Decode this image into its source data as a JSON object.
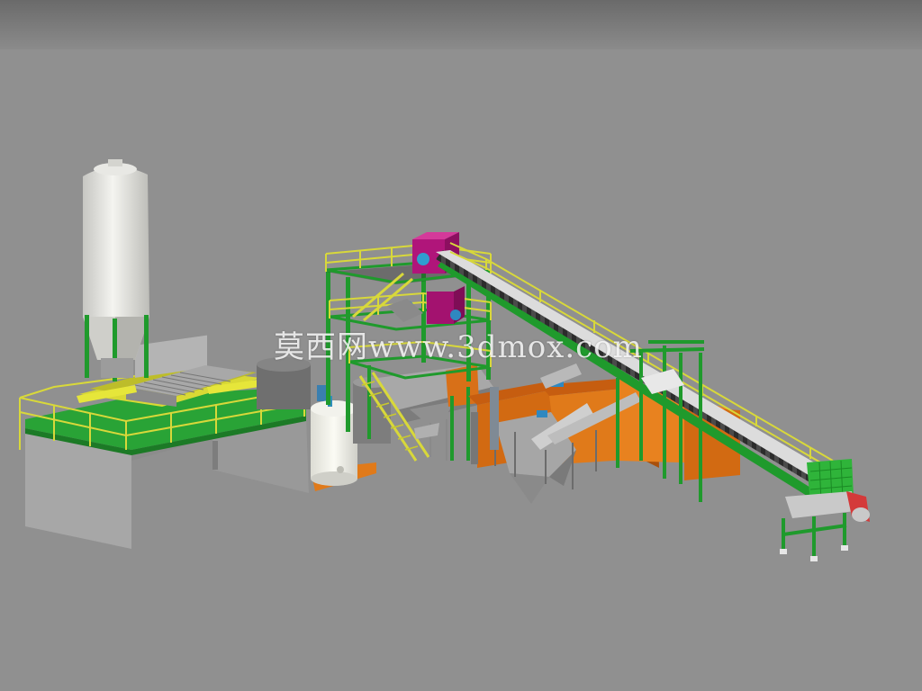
{
  "watermark": {
    "text": "莫西网www.3dmox.com"
  },
  "colors": {
    "sky_top": "#6e6e6e",
    "ground": "#909090",
    "frame_green": "#1f9a2c",
    "deck_green": "#2fb43a",
    "railing_yellow": "#d8d83a",
    "tank_white": "#eeeeea",
    "tank_shade": "#c9c9c4",
    "hopper_magenta": "#b0157a",
    "water_tank_orange": "#d26a12",
    "steel_gray": "#9a9a9a"
  }
}
